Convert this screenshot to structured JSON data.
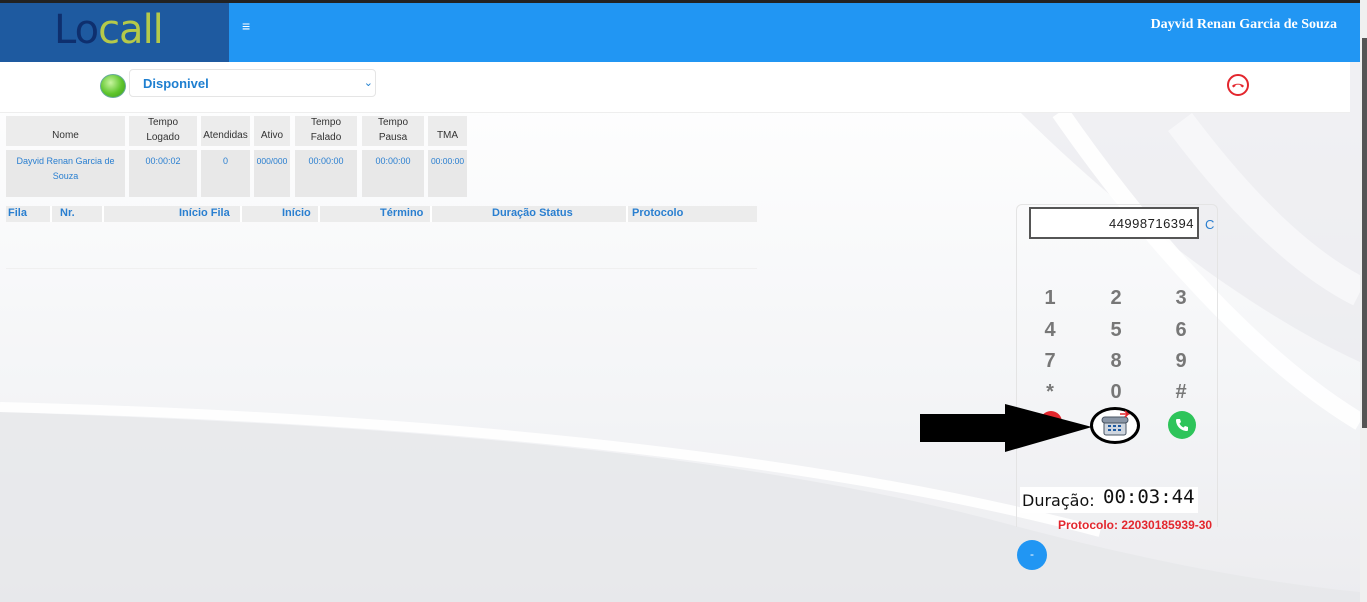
{
  "header": {
    "logo_lo": "Lo",
    "logo_call": "call",
    "menu_icon": "≡",
    "user_name": "Dayvid Renan Garcia de Souza"
  },
  "status": {
    "label": "Disponivel",
    "chevron": "⌄",
    "indicator_color": "#5ec52c"
  },
  "stats": {
    "headers": [
      [
        "",
        "Nome"
      ],
      [
        "Tempo",
        "Logado"
      ],
      [
        "",
        "Atendidas"
      ],
      [
        "",
        "Ativo"
      ],
      [
        "Tempo",
        "Falado"
      ],
      [
        "Tempo",
        "Pausa"
      ],
      [
        "",
        "TMA"
      ]
    ],
    "values": [
      "Dayvid Renan Garcia de Souza",
      "00:00:02",
      "0",
      "000/000",
      "00:00:00",
      "00:00:00",
      "00:00:00"
    ]
  },
  "queue": {
    "columns": [
      "Fila",
      "Nr.",
      "Início Fila",
      "Início",
      "Término",
      "Duração Status",
      "Protocolo"
    ]
  },
  "phone": {
    "number": "44998716394",
    "clear_label": "C",
    "keys": [
      "1",
      "2",
      "3",
      "4",
      "5",
      "6",
      "7",
      "8",
      "9",
      "*",
      "0",
      "#"
    ],
    "duration_label": "Duração:",
    "duration_value": "00:03:44",
    "protocol": "Protocolo: 22030185939-30",
    "minimize_label": "-"
  },
  "colors": {
    "header_blue": "#2196f3",
    "logo_bg": "#1e5aa0",
    "accent_red": "#e3262d",
    "accent_green": "#2ec45a"
  }
}
